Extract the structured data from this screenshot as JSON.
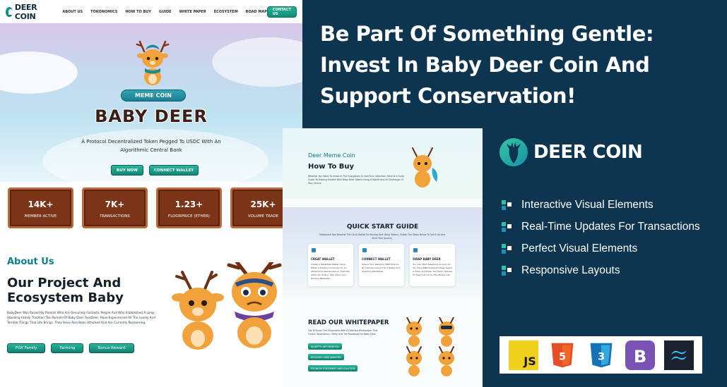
{
  "left_panel": {
    "nav": {
      "logo": "DEER COIN",
      "items": [
        "ABOUT US",
        "TOKONOMICS",
        "HOW TO BUY",
        "GUIDE",
        "WHITE PAPER",
        "ECOSYSTEM",
        "ROAD MAP"
      ],
      "contact_label": "CONTACT US"
    },
    "hero": {
      "pill": "MEME COIN",
      "title": "BABY DEER",
      "subtitle": "A Protocol Decentralized Token Pegged To USDC With An Algorithmic Central Bank",
      "buy_label": "BUY NOW",
      "connect_label": "CONNECT WALLET"
    },
    "stats": [
      {
        "value": "14K+",
        "label": "MEMBER ACTIVE"
      },
      {
        "value": "7K+",
        "label": "TRANSACTIONS"
      },
      {
        "value": "1.23+",
        "label": "FLOORPRICE (ETHER)"
      },
      {
        "value": "25K+",
        "label": "VOLUME TRADE"
      }
    ],
    "about": {
      "kicker": "About Us",
      "title": "Our Project And Ecosystem Baby",
      "body": "BabyDeer Was Raised By Parents Who Are Genuinely Fantastic People And Who Established A Long-Standing Family Tradition The Parents Of Baby Deer TooxDeer, Have Experienced All The Lovely And Terrible Things That Life Brings. They Have Also Been Attacked And Are Currently Recovering",
      "tags": [
        "FOX Family",
        "Farming",
        "Bonus Reward"
      ]
    }
  },
  "headline": "Be Part Of Something Gentle: Invest In Baby Deer Coin And Support Conservation!",
  "middle_panel": {
    "kicker": "Deer Meme Coin",
    "how_to_buy": "How To Buy",
    "how_text": "Whether You Want To Invest In The Ecosystem Or Add To A Collection, Here Is A Quick Guide To Getting Started With Baby Deer Tokens Using A Wallet And An Exchange Of Your Choice.",
    "quick_start": "QUICK START GUIDE",
    "quick_text": "Metamask Has Become The Go-To Wallet For Buying And Using Tokens, Follow The Steps Below To Set It Up And Start Your Journey.",
    "cards": [
      {
        "title": "CREAT WALLET",
        "text": "Create A MetaMask Wallet Using Either A Desktop Computer Or An iOS/Android Mobile Device. That Will Allow You To Buy, Sell, Send, And Receive BabyDeer."
      },
      {
        "title": "CONNECT WALLET",
        "text": "Ensure Your Wallet To UNM Finance By Clicking Connect To A Wallet And Selecting MetaMask."
      },
      {
        "title": "SWAP BABY DEER",
        "text": "You Can Start Swapping As Soon As You Have BNB Available! Press Select A Token And Enter The Token Address Or Search For It On The Tokens List."
      }
    ],
    "whitepaper": "READ OUR WHITEPAPER",
    "wp_text": "Get To Know The Ecosystem With A Detailed Whitepaper That Covers Tokenomics, Utility And The Roadmap For Baby Deer.",
    "wp_buttons": [
      "IN-DEPTH INFORMATION",
      "RESEARCH AND ANALYSIS",
      "PROBLEM STATEMENT AND SOLUTION"
    ]
  },
  "brand": "DEER COIN",
  "features": [
    "Interactive Visual Elements",
    "Real-Time Updates For Transactions",
    "Perfect Visual Elements",
    "Responsive Layouts"
  ],
  "tech": [
    "JS",
    "HTML5",
    "CSS3",
    "Bootstrap",
    "Tailwind"
  ],
  "colors": {
    "bg": "#0d3550",
    "accent": "#1aa58a",
    "brown": "#7c3419"
  }
}
